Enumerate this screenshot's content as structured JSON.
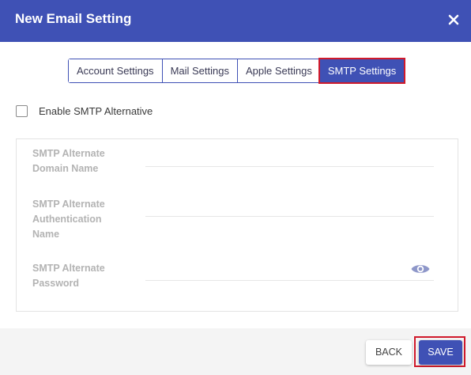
{
  "dialog": {
    "title": "New Email Setting",
    "close_icon": "close-icon"
  },
  "tabs": [
    {
      "label": "Account Settings",
      "active": false
    },
    {
      "label": "Mail Settings",
      "active": false
    },
    {
      "label": "Apple Settings",
      "active": false
    },
    {
      "label": "SMTP Settings",
      "active": true
    }
  ],
  "smtp": {
    "enable_alternative_label": "Enable SMTP Alternative",
    "enable_alternative_checked": false,
    "fields": {
      "domain_label_line1": "SMTP Alternate",
      "domain_label_line2": "Domain Name",
      "domain_value": "",
      "auth_label_line1": "SMTP Alternate",
      "auth_label_line2": "Authentication",
      "auth_label_line3": "Name",
      "auth_value": "",
      "password_label_line1": "SMTP Alternate",
      "password_label_line2": "Password",
      "password_value": "",
      "password_icon": "eye-icon"
    }
  },
  "footer": {
    "back_label": "BACK",
    "save_label": "SAVE"
  },
  "colors": {
    "primary": "#3f51b5",
    "highlight": "#d0192b",
    "label_gray": "#b3b3b3"
  }
}
